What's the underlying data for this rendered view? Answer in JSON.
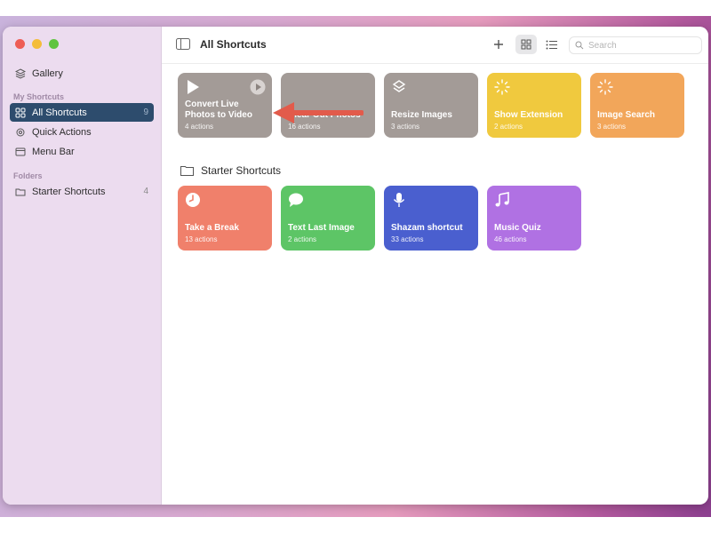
{
  "sidebar": {
    "gallery": "Gallery",
    "my_shortcuts_label": "My Shortcuts",
    "items": [
      {
        "label": "All Shortcuts",
        "count": "9"
      },
      {
        "label": "Quick Actions",
        "count": ""
      },
      {
        "label": "Menu Bar",
        "count": ""
      }
    ],
    "folders_label": "Folders",
    "folders": [
      {
        "label": "Starter Shortcuts",
        "count": "4"
      }
    ]
  },
  "toolbar": {
    "title": "All Shortcuts",
    "search_placeholder": "Search"
  },
  "shortcuts": [
    {
      "name": "Convert Live Photos to Video",
      "actions": "4 actions",
      "color": "#a39b97",
      "icon": "play-icon"
    },
    {
      "name": "Clear Out Photos",
      "actions": "16 actions",
      "color": "#a39b97",
      "icon": ""
    },
    {
      "name": "Resize Images",
      "actions": "3 actions",
      "color": "#a39b97",
      "icon": "layers-icon"
    },
    {
      "name": "Show Extension",
      "actions": "2 actions",
      "color": "#f0c93e",
      "icon": "sparkle-icon"
    },
    {
      "name": "Image Search",
      "actions": "3 actions",
      "color": "#f2a65a",
      "icon": "sparkle-icon"
    }
  ],
  "starter_folder": {
    "heading": "Starter Shortcuts",
    "shortcuts": [
      {
        "name": "Take a Break",
        "actions": "13 actions",
        "color": "#f0806b",
        "icon": "clock-icon"
      },
      {
        "name": "Text Last Image",
        "actions": "2 actions",
        "color": "#5dc566",
        "icon": "message-icon"
      },
      {
        "name": "Shazam shortcut",
        "actions": "33 actions",
        "color": "#4a5fcf",
        "icon": "microphone-icon"
      },
      {
        "name": "Music Quiz",
        "actions": "46 actions",
        "color": "#b071e3",
        "icon": "music-note-icon"
      }
    ]
  },
  "colors": {
    "sidebar_bg": "#ecdcef",
    "sidebar_selected": "#2d4c6d",
    "annotation_arrow": "#e25b4b"
  }
}
